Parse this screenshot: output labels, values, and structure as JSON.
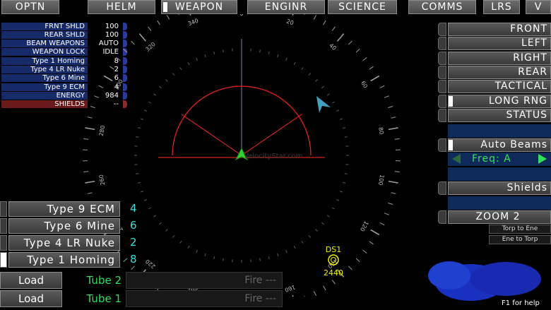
{
  "tabs": [
    {
      "label": "OPTN",
      "active": false
    },
    {
      "label": "HELM",
      "active": false
    },
    {
      "label": "WEAPON",
      "active": true
    },
    {
      "label": "ENGINR",
      "active": false
    },
    {
      "label": "SCIENCE",
      "active": false
    },
    {
      "label": "COMMS",
      "active": false
    },
    {
      "label": "LRS",
      "active": false
    },
    {
      "label": "V",
      "active": false
    }
  ],
  "status": [
    {
      "label": "FRNT SHLD",
      "value": "100"
    },
    {
      "label": "REAR SHLD",
      "value": "100"
    },
    {
      "label": "BEAM WEAPONS",
      "value": "AUTO"
    },
    {
      "label": "WEAPON LOCK",
      "value": "IDLE"
    },
    {
      "label": "Type 1 Homing",
      "value": "8"
    },
    {
      "label": "Type 4 LR Nuke",
      "value": "2"
    },
    {
      "label": "Type 6 Mine",
      "value": "6"
    },
    {
      "label": "Type 9 ECM",
      "value": "4"
    },
    {
      "label": "ENERGY",
      "value": "984"
    },
    {
      "label": "SHIELDS",
      "value": "--"
    }
  ],
  "view_buttons": {
    "front": "FRONT",
    "left": "LEFT",
    "right": "RIGHT",
    "rear": "REAR",
    "tactical": "TACTICAL",
    "long_rng": "LONG RNG",
    "status": "STATUS"
  },
  "auto_beams": "Auto Beams",
  "freq_label": "Freq: A",
  "shields_btn": "Shields",
  "zoom_btn": "ZOOM 2",
  "torp_to_ene": "Torp to Ene",
  "ene_to_torp": "Ene to Torp",
  "weapons": [
    {
      "name": "Type 9 ECM",
      "count": "4",
      "selected": false
    },
    {
      "name": "Type 6 Mine",
      "count": "6",
      "selected": false
    },
    {
      "name": "Type 4 LR Nuke",
      "count": "2",
      "selected": false
    },
    {
      "name": "Type 1 Homing",
      "count": "8",
      "selected": true
    }
  ],
  "tubes": [
    {
      "load": "Load",
      "tube": "Tube 2",
      "fire": "Fire ---"
    },
    {
      "load": "Load",
      "tube": "Tube 1",
      "fire": "Fire ---"
    }
  ],
  "target": {
    "name": "DS1",
    "range": "2440"
  },
  "watermark": "VelocityStar.com",
  "help": "F1 for help",
  "compass": {
    "headings": [
      "0",
      "20",
      "40",
      "60",
      "80",
      "100",
      "120",
      "140",
      "160",
      "180",
      "200",
      "220",
      "240",
      "260",
      "280",
      "300",
      "320",
      "340"
    ]
  },
  "colors": {
    "arc": "#d02020",
    "ship": "#30d030",
    "contact": "#40a0c0",
    "target": "#f0f000",
    "accent": "#2ee0e0",
    "tube": "#2ee05a"
  }
}
